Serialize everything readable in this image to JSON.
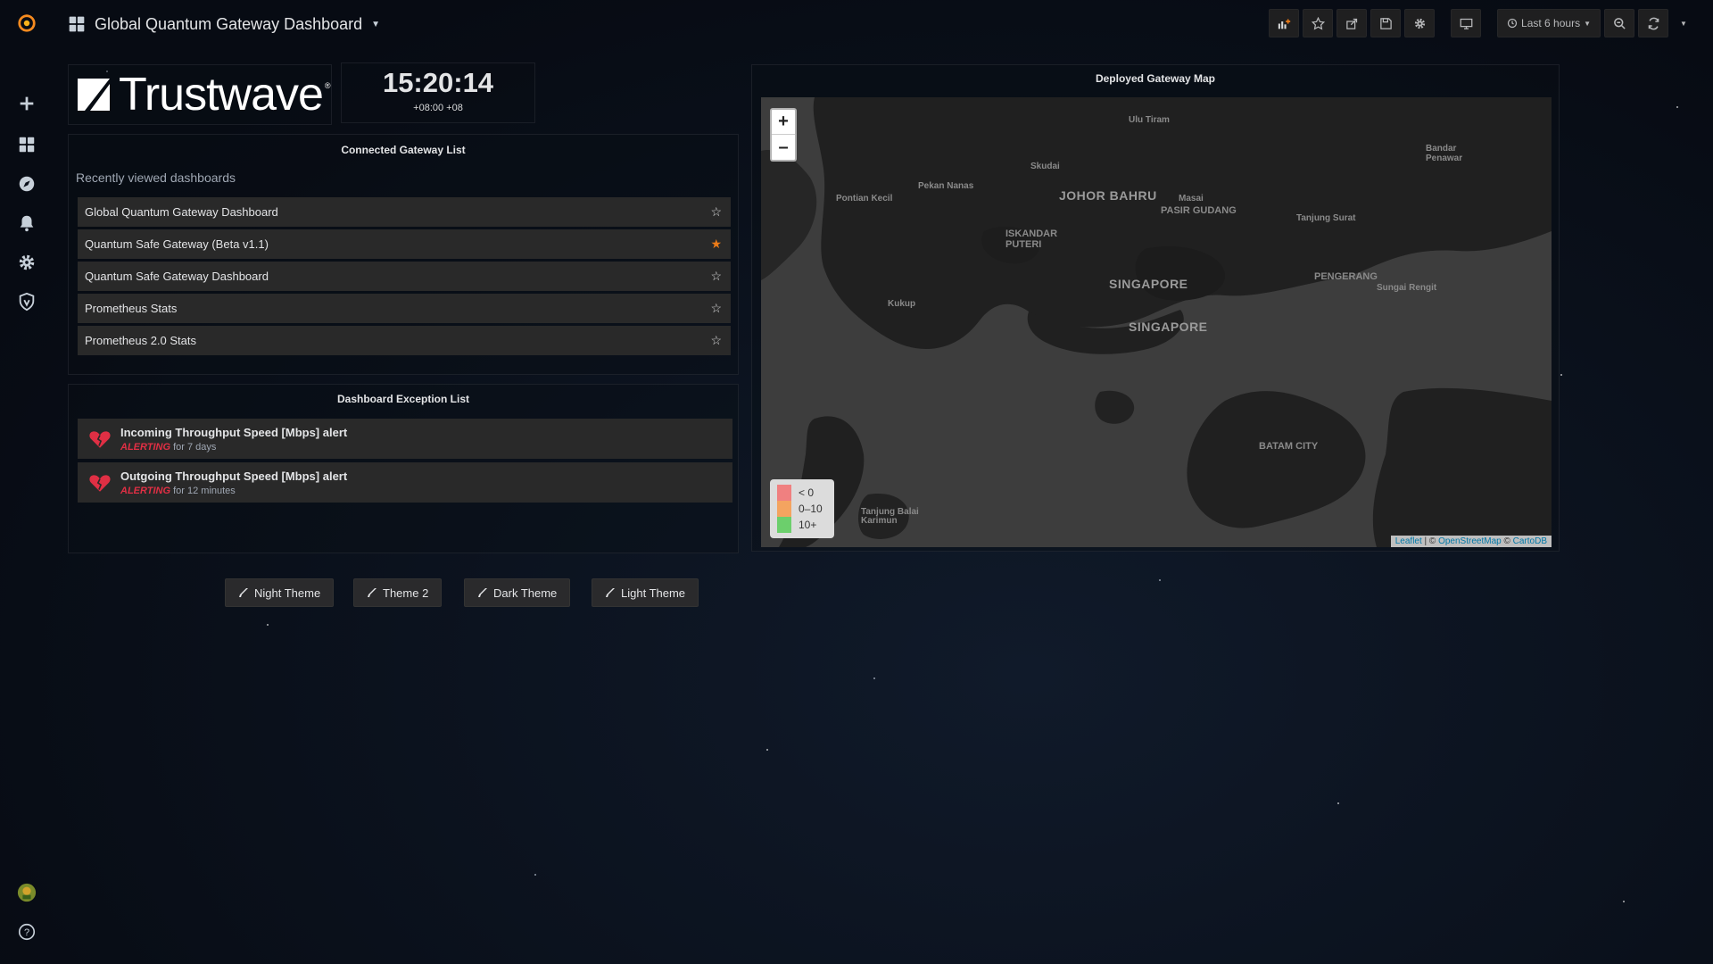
{
  "header": {
    "title": "Global Quantum Gateway Dashboard",
    "time_range": "Last 6 hours"
  },
  "clock": {
    "time": "15:20:14",
    "timezone": "+08:00 +08"
  },
  "logo": {
    "text": "Trustwave",
    "mark": "®"
  },
  "gateway_panel": {
    "title": "Connected Gateway List",
    "recent_label": "Recently viewed dashboards",
    "items": [
      {
        "name": "Global Quantum Gateway Dashboard",
        "starred": false
      },
      {
        "name": "Quantum Safe Gateway (Beta v1.1)",
        "starred": true
      },
      {
        "name": "Quantum Safe Gateway Dashboard",
        "starred": false
      },
      {
        "name": "Prometheus Stats",
        "starred": false
      },
      {
        "name": "Prometheus 2.0 Stats",
        "starred": false
      }
    ]
  },
  "exception_panel": {
    "title": "Dashboard Exception List",
    "alerts": [
      {
        "name": "Incoming Throughput Speed [Mbps] alert",
        "state": "ALERTING",
        "duration": "for 7 days"
      },
      {
        "name": "Outgoing Throughput Speed [Mbps] alert",
        "state": "ALERTING",
        "duration": "for 12 minutes"
      }
    ]
  },
  "theme_buttons": [
    "Night Theme",
    "Theme 2",
    "Dark Theme",
    "Light Theme"
  ],
  "map_panel": {
    "title": "Deployed Gateway Map",
    "zoom_in": "+",
    "zoom_out": "–",
    "legend": [
      {
        "label": "< 0",
        "color": "#f08080"
      },
      {
        "label": "0–10",
        "color": "#f4a460"
      },
      {
        "label": "10+",
        "color": "#6ccf6c"
      }
    ],
    "attribution": {
      "leaflet": "Leaflet",
      "sep1": " | © ",
      "osm": "OpenStreetMap",
      "sep2": " © ",
      "carto": "CartoDB"
    },
    "labels": {
      "ulu_tiram": "Ulu Tiram",
      "bandar_penawar": "Bandar Penawar",
      "skudai": "Skudai",
      "pontian_kecil": "Pontian Kecil",
      "pekan_nanas": "Pekan Nanas",
      "johor_bahru": "JOHOR BAHRU",
      "masai": "Masai",
      "pasir_gudang": "PASIR GUDANG",
      "tanjung_surat": "Tanjung Surat",
      "iskandar_puteri": "ISKANDAR PUTERI",
      "singapore_1": "SINGAPORE",
      "singapore_2": "SINGAPORE",
      "pengerang": "PENGERANG",
      "sungai_rengit": "Sungai Rengit",
      "kukup": "Kukup",
      "batam_city": "BATAM CITY",
      "tanjung_balai": "Tanjung Balai Karimun"
    }
  },
  "colors": {
    "accent": "#eb7b18",
    "alert": "#e02f44",
    "panel_row": "#292929"
  }
}
